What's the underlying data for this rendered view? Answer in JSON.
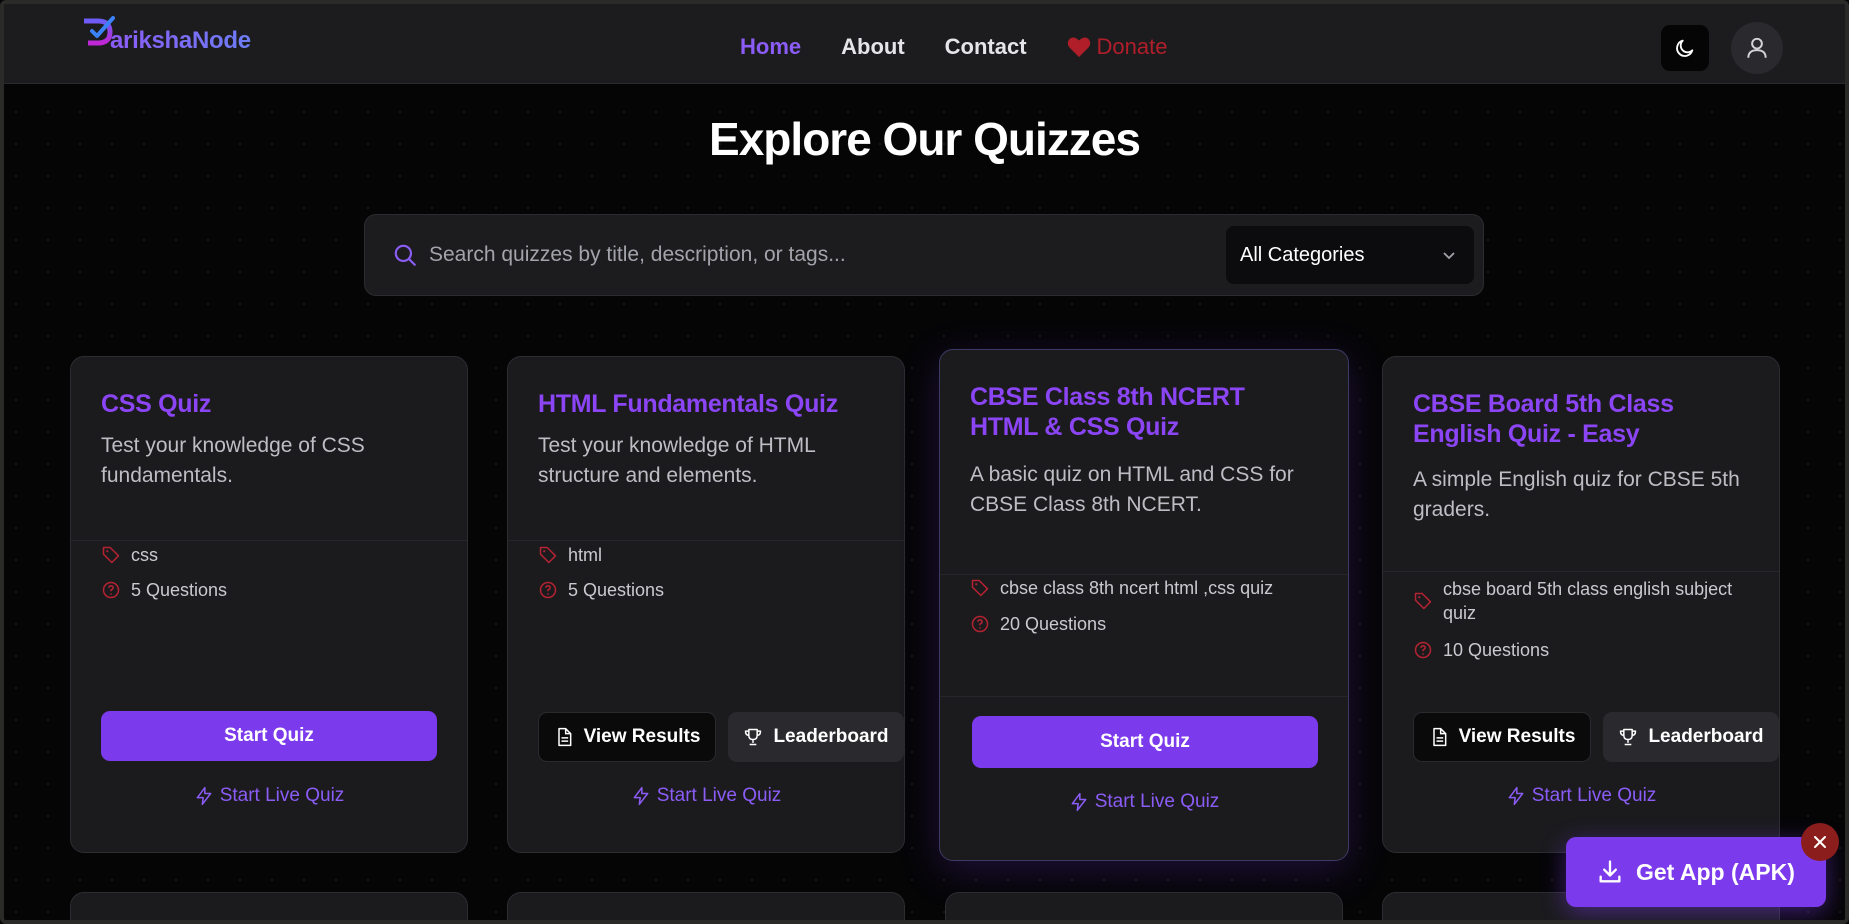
{
  "brand": {
    "name": "arikshaNode",
    "logo_letter": "P"
  },
  "nav": {
    "home": "Home",
    "about": "About",
    "contact": "Contact",
    "donate": "Donate"
  },
  "page": {
    "title": "Explore Our Quizzes"
  },
  "search": {
    "placeholder": "Search quizzes by title, description, or tags...",
    "category_value": "All Categories"
  },
  "cards": [
    {
      "title": "CSS Quiz",
      "description": "Test your knowledge of CSS fundamentals.",
      "tag": "css",
      "questions": "5 Questions",
      "primary_action": "Start Quiz",
      "live": "Start Live Quiz"
    },
    {
      "title": "HTML Fundamentals Quiz",
      "description": "Test your knowledge of HTML structure and elements.",
      "tag": "html",
      "questions": "5 Questions",
      "view_results": "View Results",
      "leaderboard": "Leaderboard",
      "live": "Start Live Quiz"
    },
    {
      "title": "CBSE Class 8th NCERT HTML & CSS Quiz",
      "description": "A basic quiz on HTML and CSS for CBSE Class 8th NCERT.",
      "tag": "cbse class 8th ncert html ,css quiz",
      "questions": "20 Questions",
      "primary_action": "Start Quiz",
      "live": "Start Live Quiz"
    },
    {
      "title": "CBSE Board 5th Class English Quiz - Easy",
      "description": "A simple English quiz for CBSE 5th graders.",
      "tag": "cbse board 5th class english subject quiz",
      "questions": "10 Questions",
      "view_results": "View Results",
      "leaderboard": "Leaderboard",
      "live": "Start Live Quiz"
    }
  ],
  "get_app": {
    "label": "Get App (APK)"
  },
  "colors": {
    "accent": "#7c3aed",
    "accent_text": "#8b45f5",
    "donate": "#b01e2a",
    "tag_icon": "#b42332"
  },
  "icons": [
    "search-icon",
    "moon-icon",
    "user-icon",
    "heart-icon",
    "tag-icon",
    "help-circle-icon",
    "file-icon",
    "trophy-icon",
    "zap-icon",
    "download-icon",
    "close-icon",
    "chevron-down-icon"
  ]
}
